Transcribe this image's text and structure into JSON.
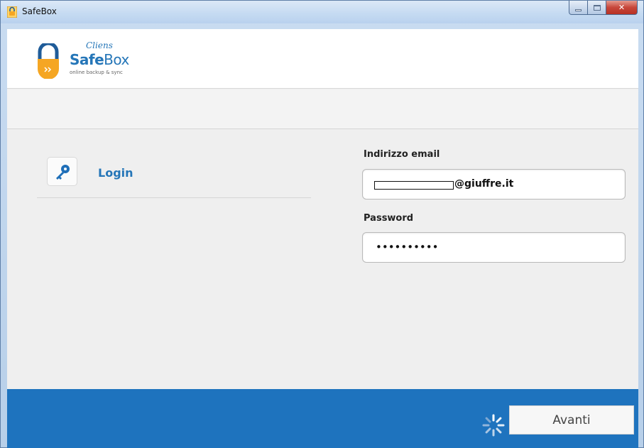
{
  "window": {
    "title": "SafeBox",
    "controls": [
      "minimize",
      "maximize",
      "close"
    ]
  },
  "logo": {
    "brand_prefix": "Cliens",
    "name_bold": "Safe",
    "name_regular": "Box",
    "tagline": "online backup & sync"
  },
  "nav": {
    "items": [
      {
        "label": "Login",
        "icon": "key-icon"
      }
    ]
  },
  "form": {
    "email": {
      "label": "Indirizzo email",
      "value_visible_part": "@giuffre.it"
    },
    "password": {
      "label": "Password",
      "value": "••••••••••"
    }
  },
  "footer": {
    "next_label": "Avanti",
    "spinner_icon": "loading-spinner-icon"
  },
  "colors": {
    "accent": "#2576b8",
    "footer": "#1e73be",
    "lock_orange": "#f5a623"
  }
}
